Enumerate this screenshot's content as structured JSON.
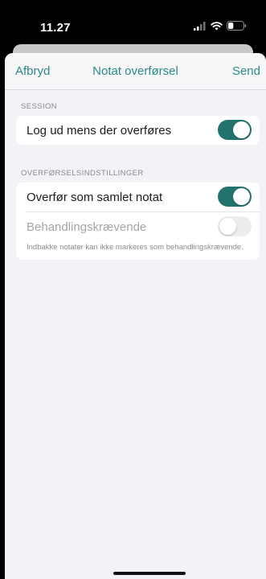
{
  "status_bar": {
    "time": "11.27",
    "icons": [
      "signal-icon",
      "wifi-icon",
      "battery-icon"
    ],
    "battery_level": 0.35
  },
  "nav": {
    "cancel_label": "Afbryd",
    "title": "Notat overførsel",
    "send_label": "Send"
  },
  "session": {
    "header": "SESSION",
    "logout_label": "Log ud mens der overføres",
    "logout_on": true
  },
  "transfer": {
    "header": "OVERFØRSELSINDSTILLINGER",
    "combined_label": "Overfør som samlet notat",
    "combined_on": true,
    "treatment_label": "Behandlingskrævende",
    "treatment_on": false,
    "treatment_enabled": false,
    "treatment_note": "Indbakke notater kan ikke markeres som behandlingskrævende."
  },
  "colors": {
    "accent": "#2a8a86",
    "toggle_on": "#22736e",
    "background": "#f2f2f7"
  }
}
